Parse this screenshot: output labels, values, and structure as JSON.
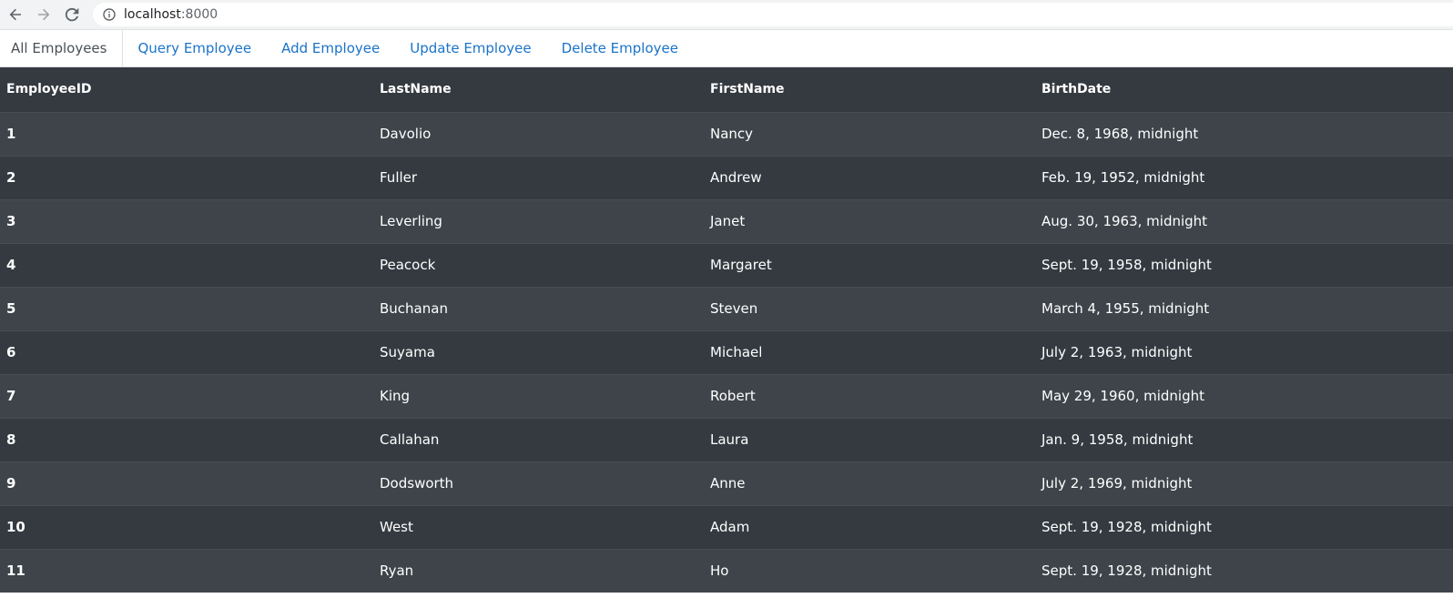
{
  "browser": {
    "url_host": "localhost",
    "url_port": ":8000"
  },
  "nav": {
    "tabs": [
      {
        "label": "All Employees",
        "active": true
      },
      {
        "label": "Query Employee",
        "active": false
      },
      {
        "label": "Add Employee",
        "active": false
      },
      {
        "label": "Update Employee",
        "active": false
      },
      {
        "label": "Delete Employee",
        "active": false
      }
    ]
  },
  "table": {
    "columns": [
      "EmployeeID",
      "LastName",
      "FirstName",
      "BirthDate"
    ],
    "rows": [
      [
        "1",
        "Davolio",
        "Nancy",
        "Dec. 8, 1968, midnight"
      ],
      [
        "2",
        "Fuller",
        "Andrew",
        "Feb. 19, 1952, midnight"
      ],
      [
        "3",
        "Leverling",
        "Janet",
        "Aug. 30, 1963, midnight"
      ],
      [
        "4",
        "Peacock",
        "Margaret",
        "Sept. 19, 1958, midnight"
      ],
      [
        "5",
        "Buchanan",
        "Steven",
        "March 4, 1955, midnight"
      ],
      [
        "6",
        "Suyama",
        "Michael",
        "July 2, 1963, midnight"
      ],
      [
        "7",
        "King",
        "Robert",
        "May 29, 1960, midnight"
      ],
      [
        "8",
        "Callahan",
        "Laura",
        "Jan. 9, 1958, midnight"
      ],
      [
        "9",
        "Dodsworth",
        "Anne",
        "July 2, 1969, midnight"
      ],
      [
        "10",
        "West",
        "Adam",
        "Sept. 19, 1928, midnight"
      ],
      [
        "11",
        "Ryan",
        "Ho",
        "Sept. 19, 1928, midnight"
      ]
    ]
  },
  "colors": {
    "link": "#1a73c8",
    "table_bg": "#343a40",
    "table_stripe": "#3e444a"
  },
  "icons": {
    "back": "arrow-left-icon",
    "forward": "arrow-right-icon",
    "reload": "reload-icon",
    "info": "info-icon"
  }
}
